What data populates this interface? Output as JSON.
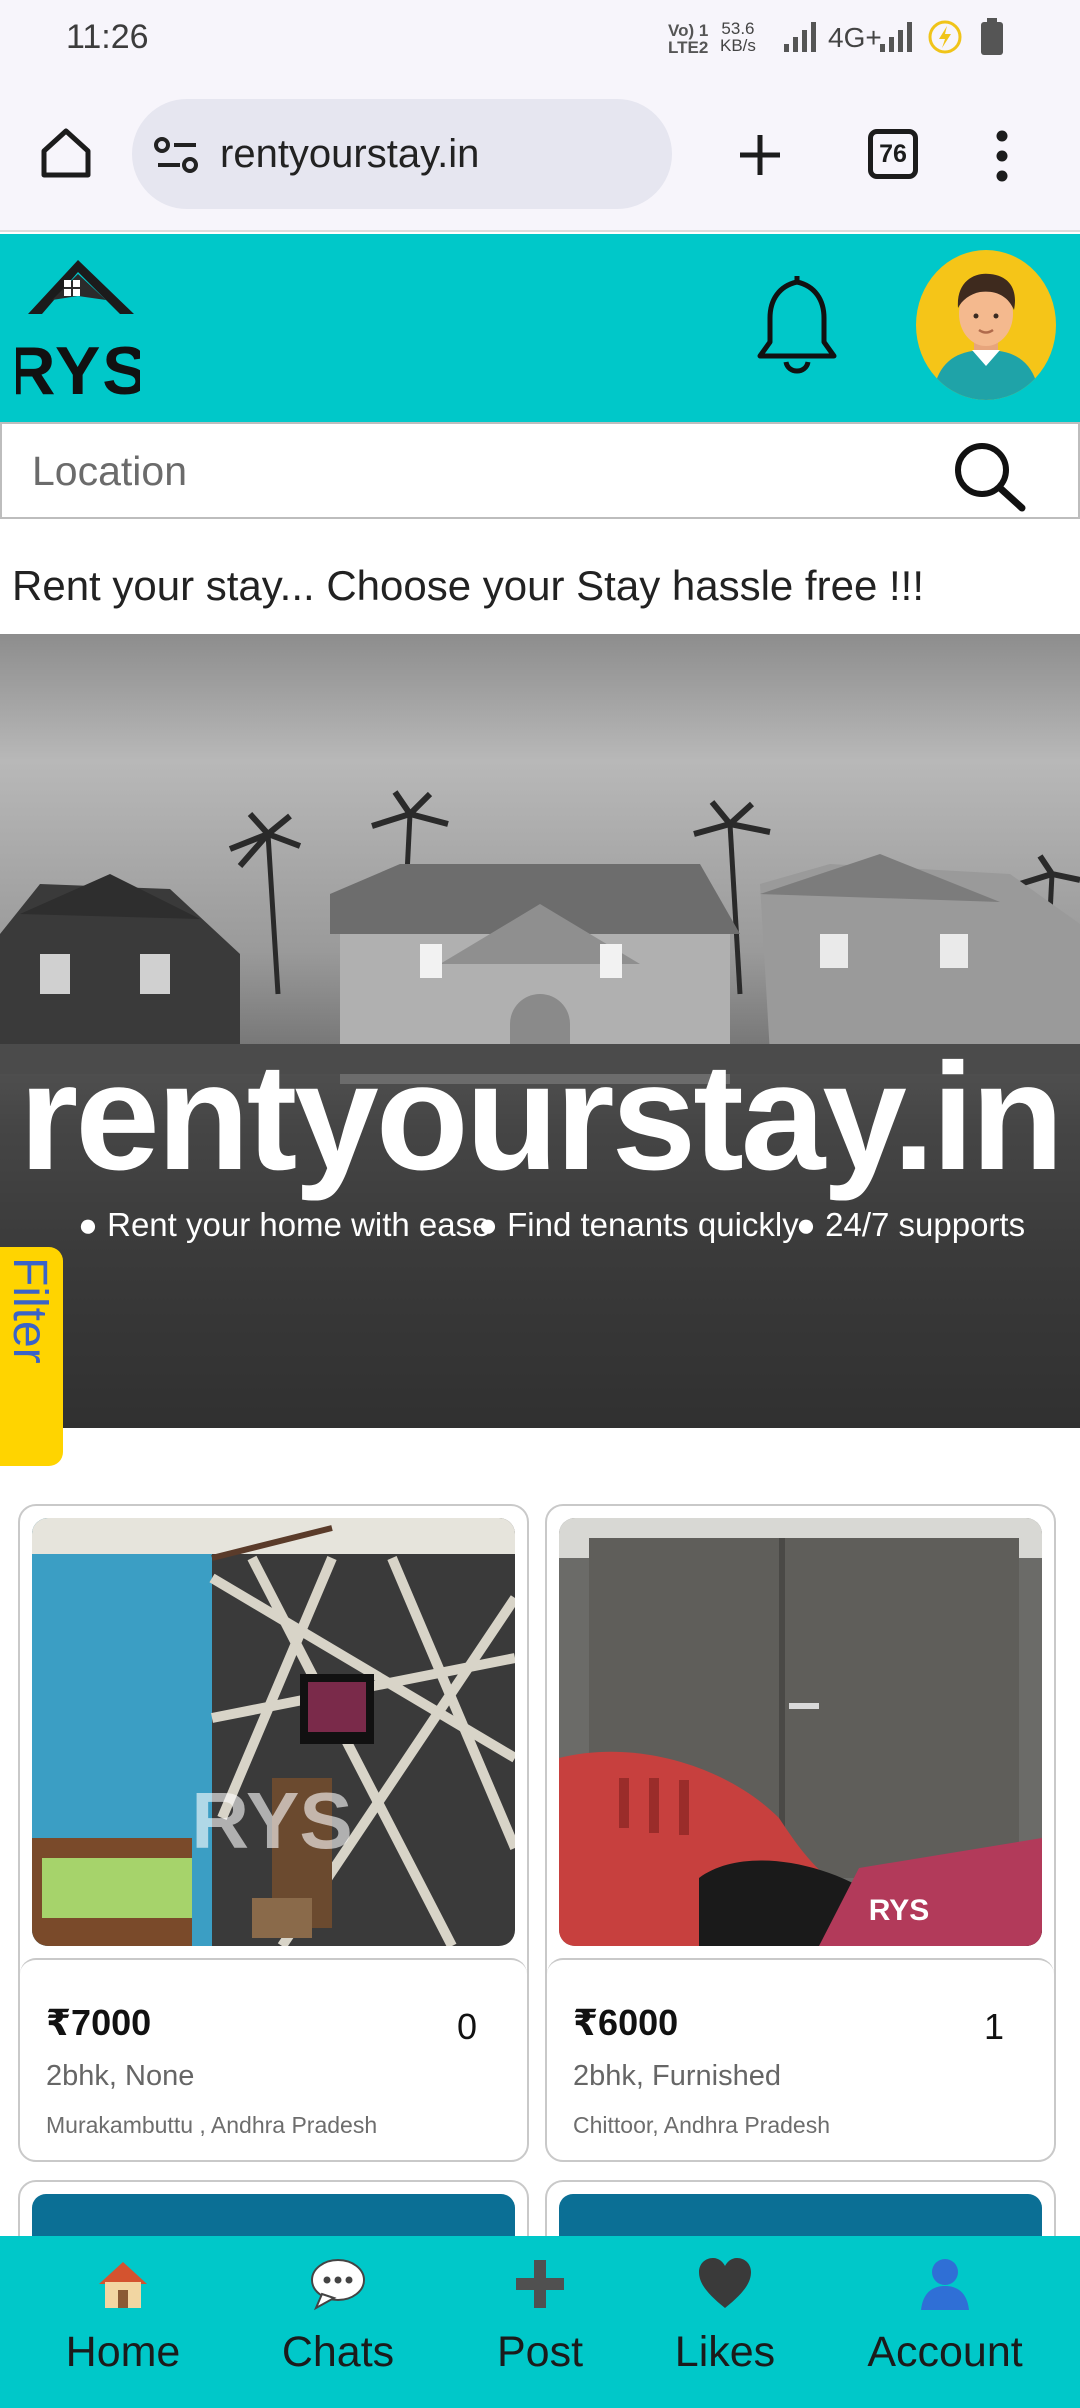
{
  "status_bar": {
    "time": "11:26",
    "volte": "Vo) 1",
    "lte2": "LTE2",
    "speed_value": "53.6",
    "speed_unit": "KB/s",
    "network": "4G+"
  },
  "browser": {
    "url": "rentyourstay.in",
    "tab_count": "76"
  },
  "header": {
    "logo_text": "RYS"
  },
  "search": {
    "placeholder": "Location"
  },
  "tagline": "Rent your stay... Choose your Stay hassle free !!!",
  "banner": {
    "title": "rentyourstay.in",
    "bullets": [
      "Rent your home with ease",
      "Find tenants quickly",
      "24/7 supports"
    ]
  },
  "filter": {
    "label": "Filter"
  },
  "listings": [
    {
      "price": "₹7000",
      "likes": "0",
      "type": "2bhk, None",
      "location": "Murakambuttu , Andhra Pradesh",
      "watermark": "RYS"
    },
    {
      "price": "₹6000",
      "likes": "1",
      "type": "2bhk, Furnished",
      "location": "Chittoor, Andhra Pradesh",
      "watermark": "RYS"
    }
  ],
  "bottom_nav": [
    {
      "label": "Home",
      "icon": "home-icon"
    },
    {
      "label": "Chats",
      "icon": "chat-icon"
    },
    {
      "label": "Post",
      "icon": "plus-icon"
    },
    {
      "label": "Likes",
      "icon": "heart-icon"
    },
    {
      "label": "Account",
      "icon": "account-icon"
    }
  ],
  "colors": {
    "brand_teal": "#00c8c9",
    "filter_yellow": "#ffd400",
    "avatar_yellow": "#f5c518"
  }
}
